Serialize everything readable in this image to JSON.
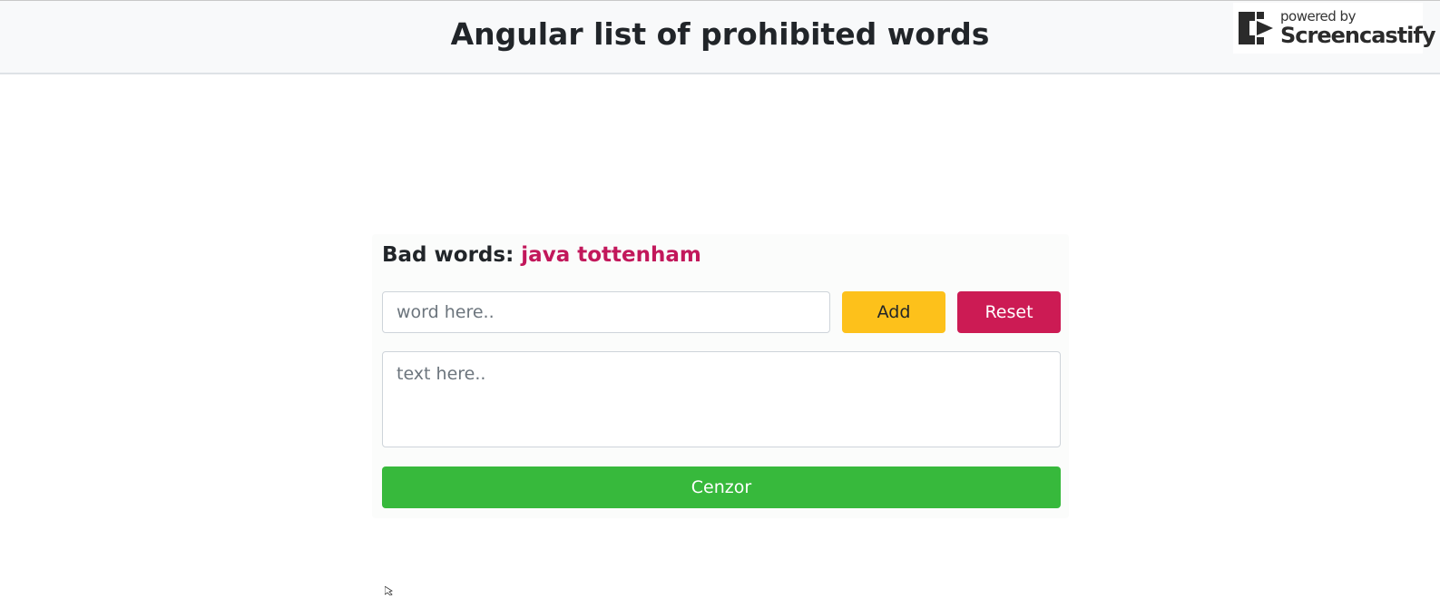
{
  "header": {
    "title": "Angular list of prohibited words"
  },
  "watermark": {
    "powered_by": "powered by",
    "brand": "Screencastify",
    "icon": "screencastify-logo-icon"
  },
  "censor_form": {
    "bad_words_label": "Bad words:",
    "bad_words_list": "java tottenham",
    "word_input": {
      "placeholder": "word here..",
      "value": ""
    },
    "add_label": "Add",
    "reset_label": "Reset",
    "text_input": {
      "placeholder": "text here..",
      "value": ""
    },
    "cenzor_label": "Cenzor"
  },
  "colors": {
    "accent_bad_words": "#c2185b",
    "add_button": "#fdc11b",
    "reset_button": "#cc1b54",
    "cenzor_button": "#37b93c"
  }
}
